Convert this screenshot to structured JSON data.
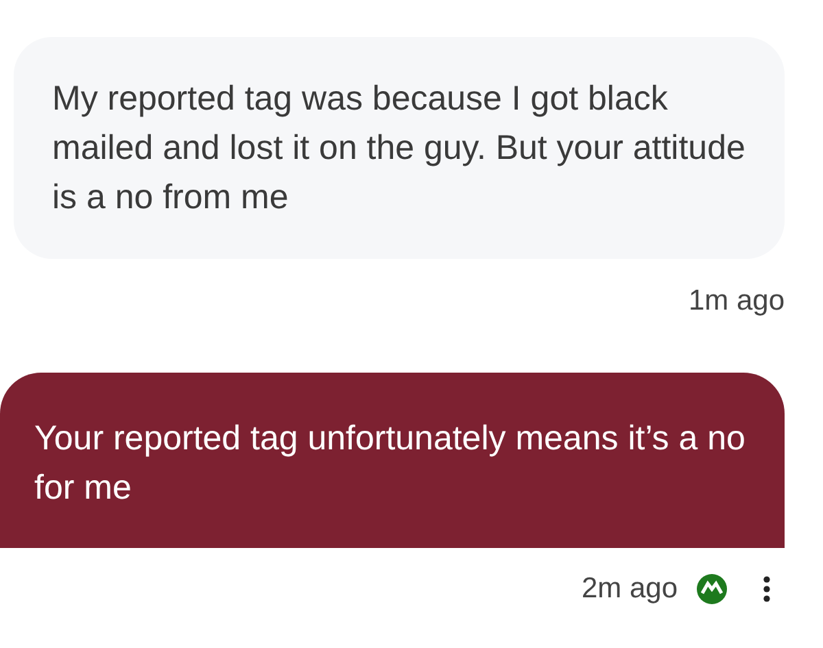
{
  "messages": [
    {
      "kind": "received",
      "text": "My reported tag was because I got black mailed and lost it on the guy. But your attitude is a no from me",
      "time": "1m ago"
    },
    {
      "kind": "sent",
      "text": "Your reported tag unfortunately means it’s a no for me",
      "time": "2m ago"
    }
  ]
}
